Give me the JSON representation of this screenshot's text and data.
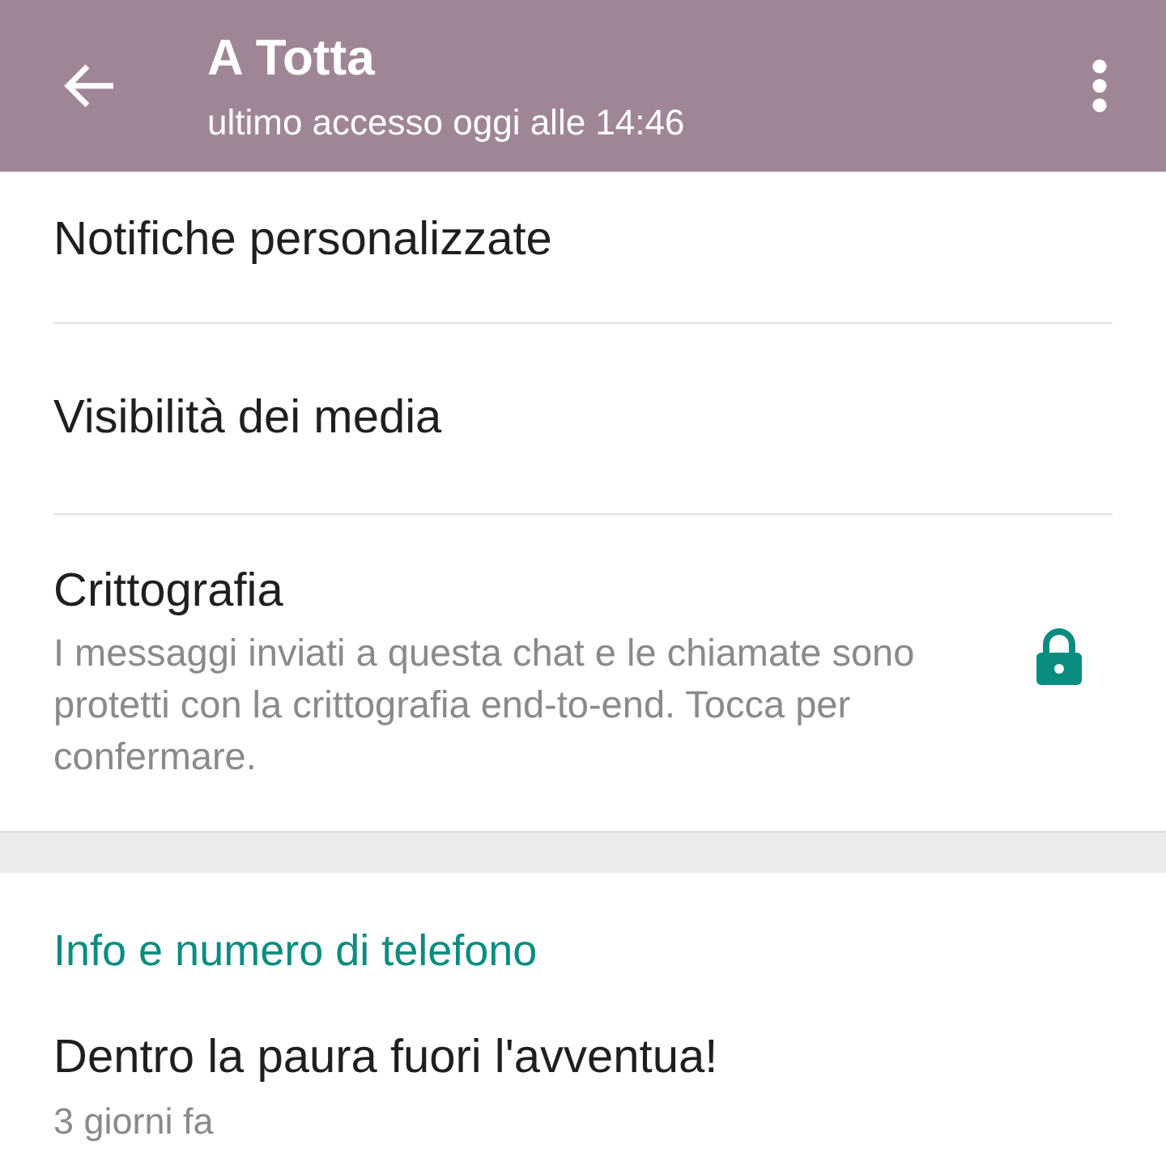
{
  "header": {
    "title": "A Totta",
    "subtitle": "ultimo accesso oggi alle 14:46"
  },
  "settings": [
    {
      "kind": "plain",
      "label": "Notifiche personalizzate"
    },
    {
      "kind": "plain",
      "label": "Visibilità dei media"
    },
    {
      "kind": "secure",
      "label": "Crittografia",
      "description": "I messaggi inviati a questa chat e le chiamate sono protetti con la crittografia end-to-end. Tocca per confermare."
    }
  ],
  "info": {
    "heading": "Info e numero di telefono",
    "about": "Dentro la paura fuori l'avventua!",
    "date": "3 giorni fa"
  }
}
